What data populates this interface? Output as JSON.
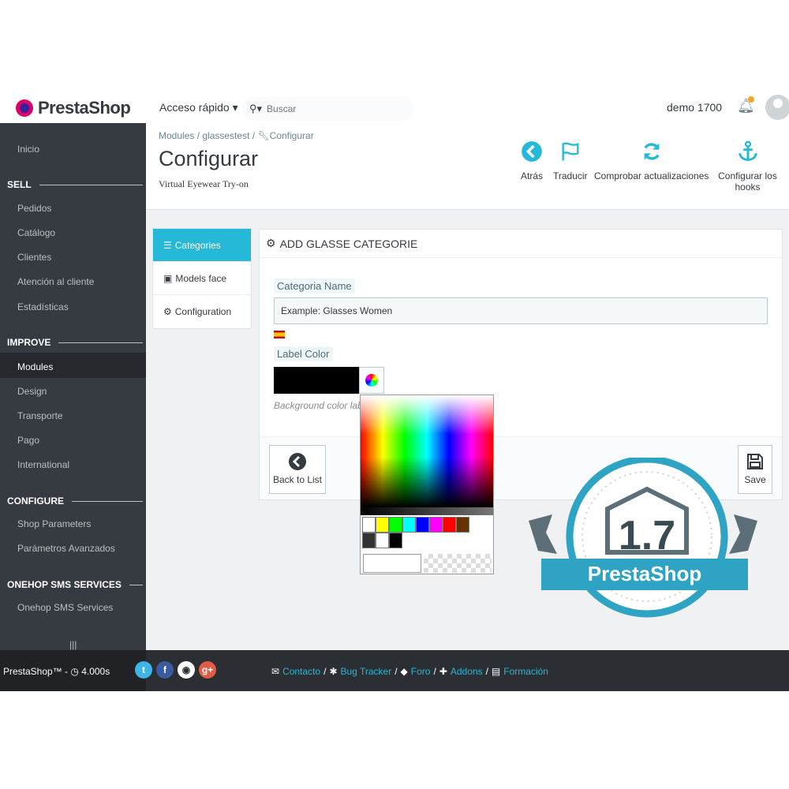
{
  "header": {
    "logo": "PrestaShop",
    "quick_access": "Acceso rápido",
    "search_placeholder": "Buscar",
    "shop_name": "demo 1700"
  },
  "sidebar": {
    "home": "Inicio",
    "sections": [
      {
        "title": "SELL",
        "items": [
          "Pedidos",
          "Catálogo",
          "Clientes",
          "Atención al cliente",
          "Estadísticas"
        ]
      },
      {
        "title": "IMPROVE",
        "items": [
          "Modules",
          "Design",
          "Transporte",
          "Pago",
          "International"
        ]
      },
      {
        "title": "CONFIGURE",
        "items": [
          "Shop Parameters",
          "Parámetros Avanzados"
        ]
      },
      {
        "title": "ONEHOP SMS SERVICES",
        "items": [
          "Onehop SMS Services"
        ]
      }
    ],
    "active_item": "Modules",
    "handle": "|||"
  },
  "page": {
    "breadcrumb": [
      "Modules",
      "glassestest",
      "Configurar"
    ],
    "title": "Configurar",
    "subtitle": "Virtual Eyewear Try-on",
    "toolbar": [
      "Atrás",
      "Traducir",
      "Comprobar actualizaciones",
      "Configurar los hooks"
    ]
  },
  "tabs": [
    "Categories",
    "Models face",
    "Configuration"
  ],
  "active_tab": "Categories",
  "panel": {
    "heading": "ADD GLASSE CATEGORIE",
    "category_label": "Categoria Name",
    "category_value": "Example: Glasses Women",
    "color_label": "Label Color",
    "color_value": "#000000",
    "color_help": "Background color label",
    "back_label": "Back to List",
    "save_label": "Save"
  },
  "picker": {
    "presets": [
      "#ffffff",
      "#ffff00",
      "#00ff00",
      "#00ffff",
      "#0000ff",
      "#ff00ff",
      "#ff0000",
      "#663300",
      "#333333",
      "#ffffff",
      "#000000"
    ]
  },
  "badge": {
    "version": "1.7",
    "brand": "PrestaShop"
  },
  "footer": {
    "version": "PrestaShop™ - ",
    "time": "4.000s",
    "links": [
      "Contacto",
      "Bug Tracker",
      "Foro",
      "Addons",
      "Formación"
    ]
  },
  "colors": {
    "accent": "#25b9d7",
    "sidebar": "#363a41",
    "footer": "#2b2e33",
    "badge": "#2fa3c4"
  }
}
